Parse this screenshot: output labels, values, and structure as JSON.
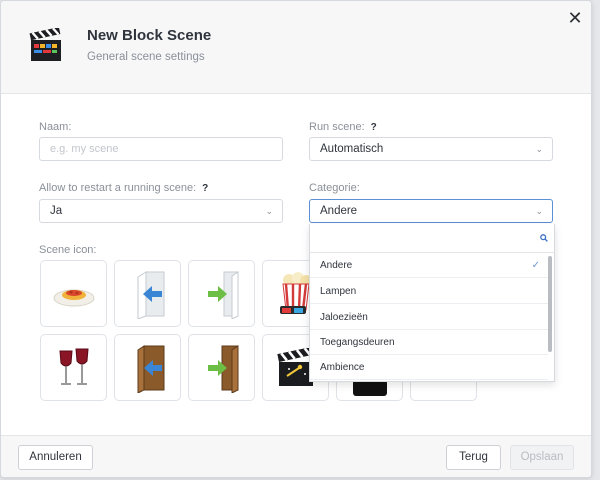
{
  "header": {
    "title": "New Block Scene",
    "subtitle": "General scene settings",
    "icon": "clapperboard-icon",
    "close_icon": "close-icon"
  },
  "form": {
    "naam": {
      "label": "Naam:",
      "placeholder": "e.g. my scene",
      "value": ""
    },
    "run_scene": {
      "label": "Run scene:",
      "help": "?",
      "value": "Automatisch"
    },
    "allow_restart": {
      "label": "Allow to restart a running scene:",
      "help": "?",
      "value": "Ja"
    },
    "categorie": {
      "label": "Categorie:",
      "value": "Andere"
    },
    "scene_icon": {
      "label": "Scene icon:"
    }
  },
  "dropdown": {
    "search_placeholder": "",
    "items": [
      "Andere",
      "Lampen",
      "Jaloezieën",
      "Toegangsdeuren",
      "Ambience"
    ],
    "selected": "Andere"
  },
  "icons": [
    "pasta-plate-icon",
    "door-enter-arrow-icon",
    "door-exit-arrow-icon",
    "popcorn-3d-glasses-icon",
    "wine-glasses-icon",
    "wooden-door-enter-icon",
    "wooden-door-exit-icon",
    "movie-clapper-icon"
  ],
  "footer": {
    "cancel_label": "Annuleren",
    "back_label": "Terug",
    "save_label": "Opslaan"
  },
  "colors": {
    "accent": "#5b8fd6",
    "background": "#ffffff",
    "panel": "#f7f7f8"
  }
}
